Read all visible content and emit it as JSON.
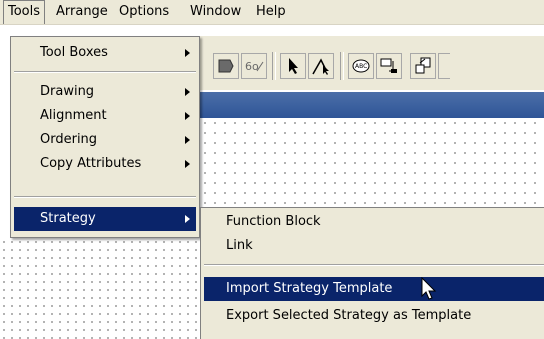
{
  "menubar": {
    "items": [
      {
        "label": "Tools"
      },
      {
        "label": "Arrange"
      },
      {
        "label": "Options"
      },
      {
        "label": "Window"
      },
      {
        "label": "Help"
      }
    ]
  },
  "tools_menu": {
    "items": [
      {
        "label": "Tool Boxes",
        "has_submenu": true
      },
      {
        "label": "Drawing",
        "has_submenu": true
      },
      {
        "label": "Alignment",
        "has_submenu": true
      },
      {
        "label": "Ordering",
        "has_submenu": true
      },
      {
        "label": "Copy Attributes",
        "has_submenu": true
      },
      {
        "label": "Strategy",
        "has_submenu": true,
        "highlighted": true
      }
    ]
  },
  "strategy_submenu": {
    "items": [
      {
        "label": "Function Block"
      },
      {
        "label": "Link"
      },
      {
        "label": "Import Strategy Template",
        "highlighted": true
      },
      {
        "label": "Export Selected Strategy as Template"
      }
    ]
  },
  "toolbar": {
    "buttons": [
      {
        "icon": "function-block-icon"
      },
      {
        "icon": "link-tool-icon"
      },
      {
        "icon": "select-arrow-icon"
      },
      {
        "icon": "connect-arrow-icon"
      },
      {
        "icon": "text-label-icon"
      },
      {
        "icon": "tag-insert-icon"
      },
      {
        "icon": "export-icon"
      }
    ]
  },
  "colors": {
    "menu_bg": "#ece9d8",
    "highlight": "#0a246a",
    "title_bar": "#2f5597"
  }
}
